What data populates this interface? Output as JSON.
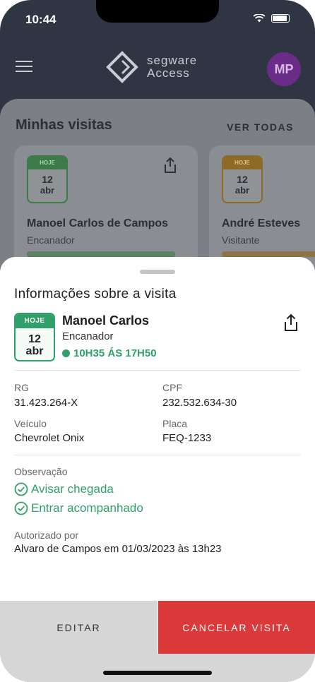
{
  "status_bar": {
    "time": "10:44"
  },
  "header": {
    "brand_line1": "segware",
    "brand_line2": "Access",
    "avatar_initials": "MP"
  },
  "background": {
    "section_title": "Minhas visitas",
    "see_all_label": "VER TODAS",
    "cards": [
      {
        "badge": "HOJE",
        "day": "12",
        "month": "abr",
        "name": "Manoel Carlos de Campos",
        "role": "Encanador"
      },
      {
        "badge": "HOJE",
        "day": "12",
        "month": "abr",
        "name": "André Esteves",
        "role": "Visitante"
      }
    ]
  },
  "sheet": {
    "title": "Informações sobre a visita",
    "calendar": {
      "badge": "HOJE",
      "day": "12",
      "month": "abr"
    },
    "visitor_name": "Manoel Carlos",
    "visitor_role": "Encanador",
    "visit_time": "10H35 ÁS 17H50",
    "fields": {
      "rg_label": "RG",
      "rg_value": "31.423.264-X",
      "cpf_label": "CPF",
      "cpf_value": "232.532.634-30",
      "vehicle_label": "Veículo",
      "vehicle_value": "Chevrolet Onix",
      "plate_label": "Placa",
      "plate_value": "FEQ-1233"
    },
    "observation_label": "Observação",
    "observations": [
      "Avisar chegada",
      "Entrar acompanhado"
    ],
    "authorized_label": "Autorizado por",
    "authorized_value": "Alvaro de Campos em 01/03/2023 às 13h23",
    "edit_label": "EDITAR",
    "cancel_label": "CANCELAR VISITA"
  },
  "colors": {
    "accent_green": "#2fa06a",
    "cancel_red": "#dc3a3a",
    "header_bg": "#2f3542"
  }
}
